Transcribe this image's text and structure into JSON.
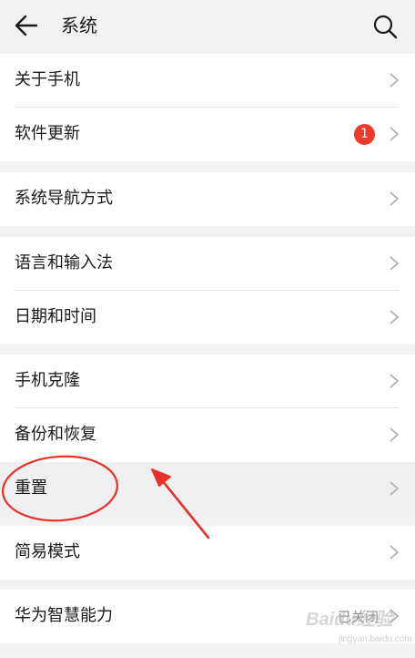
{
  "header": {
    "title": "系统",
    "back_icon": "arrow-left-icon",
    "search_icon": "search-icon"
  },
  "groups": [
    {
      "items": [
        {
          "label": "关于手机"
        },
        {
          "label": "软件更新",
          "badge": "1"
        }
      ]
    },
    {
      "items": [
        {
          "label": "系统导航方式"
        }
      ]
    },
    {
      "items": [
        {
          "label": "语言和输入法"
        },
        {
          "label": "日期和时间"
        }
      ]
    },
    {
      "items": [
        {
          "label": "手机克隆"
        },
        {
          "label": "备份和恢复"
        },
        {
          "label": "重置"
        }
      ]
    },
    {
      "items": [
        {
          "label": "简易模式"
        }
      ]
    },
    {
      "items": [
        {
          "label": "华为智慧能力",
          "status": "已关闭"
        }
      ]
    }
  ],
  "watermark": {
    "text": "Baidu经验",
    "sub": "jingyan.baidu.com"
  },
  "colors": {
    "background": "#f2f2f2",
    "badge": "#f0392b",
    "annotation": "#e8312b"
  }
}
